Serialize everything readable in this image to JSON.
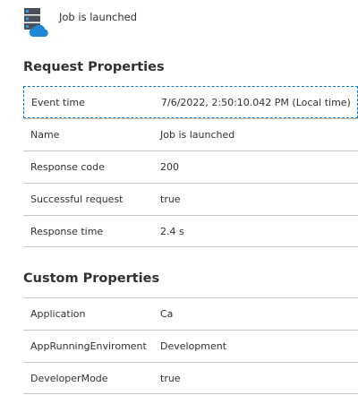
{
  "header": {
    "icon": "server-cloud-icon",
    "title": "Job is launched"
  },
  "request_properties": {
    "heading": "Request Properties",
    "rows": [
      {
        "key": "Event time",
        "value": "7/6/2022, 2:50:10.042 PM (Local time)"
      },
      {
        "key": "Name",
        "value": "Job is launched"
      },
      {
        "key": "Response code",
        "value": "200"
      },
      {
        "key": "Successful request",
        "value": "true"
      },
      {
        "key": "Response time",
        "value": "2.4 s"
      }
    ]
  },
  "custom_properties": {
    "heading": "Custom Properties",
    "rows": [
      {
        "key": "Application",
        "value": "Ca"
      },
      {
        "key": "AppRunningEnviroment",
        "value": "Development"
      },
      {
        "key": "DeveloperMode",
        "value": "true"
      }
    ]
  },
  "colors": {
    "focus_border": "#0078d4",
    "divider": "#c8c6c4",
    "icon_server": "#4a4f5a",
    "icon_cloud": "#1f85d8"
  }
}
